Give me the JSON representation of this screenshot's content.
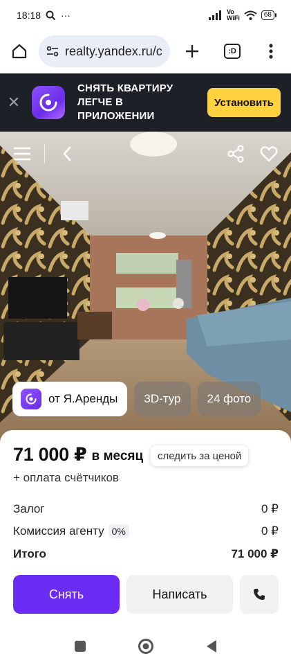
{
  "status_bar": {
    "time": "18:18",
    "ellipsis": "···",
    "network_top": "Vo",
    "network_bottom": "WiFi",
    "battery": "68"
  },
  "browser": {
    "url": "realty.yandex.ru/c",
    "tabs_label": ":D",
    "icons": [
      "home-icon",
      "site-settings-icon",
      "plus-icon",
      "tabs-icon",
      "more-vert-icon"
    ]
  },
  "promo_banner": {
    "text": "СНЯТЬ КВАРТИРУ ЛЕГЧЕ В ПРИЛОЖЕНИИ",
    "install_label": "Установить",
    "close_glyph": "✕"
  },
  "listing": {
    "chips": {
      "arenda": "от Я.Аренды",
      "tour": "3D-тур",
      "photos": "24 фото"
    },
    "price": "71 000 ₽",
    "price_period": "в месяц",
    "watch_price": "следить за ценой",
    "meter_note": "+ оплата счётчиков",
    "deposit_label": "Залог",
    "deposit_value": "0 ₽",
    "commission_label": "Комиссия агенту",
    "commission_badge": "0%",
    "commission_value": "0 ₽",
    "total_label": "Итого",
    "total_value": "71 000 ₽"
  },
  "actions": {
    "rent_label": "Снять",
    "write_label": "Написать"
  },
  "colors": {
    "brand_purple": "#6a2cf2",
    "install_yellow": "#ffd23f",
    "banner_bg": "#1d2026"
  }
}
